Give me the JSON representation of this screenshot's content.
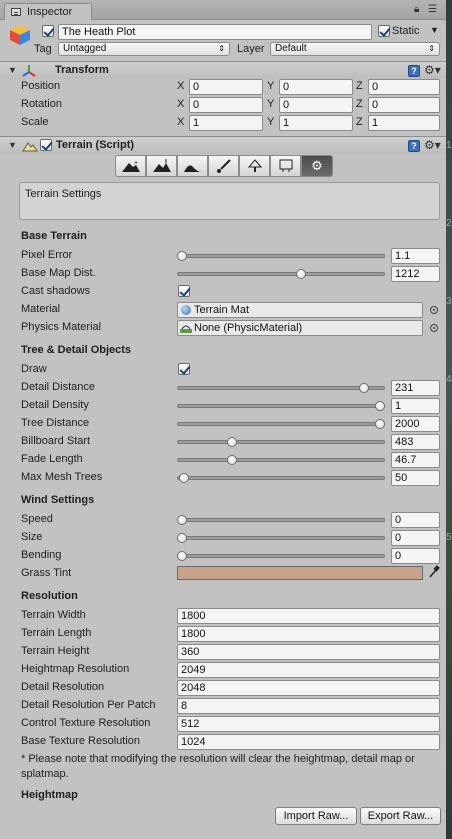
{
  "tab": {
    "title": "Inspector"
  },
  "object": {
    "name": "The Heath Plot",
    "static_label": "Static",
    "tag_label": "Tag",
    "tag_value": "Untagged",
    "layer_label": "Layer",
    "layer_value": "Default"
  },
  "transform": {
    "title": "Transform",
    "rows": [
      {
        "label": "Position",
        "x": "0",
        "y": "0",
        "z": "0"
      },
      {
        "label": "Rotation",
        "x": "0",
        "y": "0",
        "z": "0"
      },
      {
        "label": "Scale",
        "x": "1",
        "y": "1",
        "z": "1"
      }
    ],
    "axis": {
      "x": "X",
      "y": "Y",
      "z": "Z"
    }
  },
  "terrain": {
    "title": "Terrain (Script)",
    "settings_text": "Terrain Settings",
    "base": {
      "heading": "Base Terrain",
      "pixel_error": {
        "label": "Pixel Error",
        "value": "1.1",
        "fraction": 0.0
      },
      "base_map_dist": {
        "label": "Base Map Dist.",
        "value": "1212",
        "fraction": 0.6
      },
      "cast_shadows": {
        "label": "Cast shadows",
        "checked": true
      },
      "material": {
        "label": "Material",
        "value": "Terrain Mat"
      },
      "physics_material": {
        "label": "Physics Material",
        "value": "None (PhysicMaterial)"
      }
    },
    "tree": {
      "heading": "Tree & Detail Objects",
      "draw": {
        "label": "Draw",
        "checked": true
      },
      "detail_distance": {
        "label": "Detail Distance",
        "value": "231",
        "fraction": 0.92
      },
      "detail_density": {
        "label": "Detail Density",
        "value": "1",
        "fraction": 1.0
      },
      "tree_distance": {
        "label": "Tree Distance",
        "value": "2000",
        "fraction": 1.0
      },
      "billboard_start": {
        "label": "Billboard Start",
        "value": "483",
        "fraction": 0.25
      },
      "fade_length": {
        "label": "Fade Length",
        "value": "46.7",
        "fraction": 0.25
      },
      "max_mesh_trees": {
        "label": "Max Mesh Trees",
        "value": "50",
        "fraction": 0.01
      }
    },
    "wind": {
      "heading": "Wind Settings",
      "speed": {
        "label": "Speed",
        "value": "0",
        "fraction": 0.0
      },
      "size": {
        "label": "Size",
        "value": "0",
        "fraction": 0.0
      },
      "bending": {
        "label": "Bending",
        "value": "0",
        "fraction": 0.0
      },
      "grass_tint": {
        "label": "Grass Tint",
        "color": "#c5a289"
      }
    },
    "resolution": {
      "heading": "Resolution",
      "rows": [
        {
          "label": "Terrain Width",
          "value": "1800"
        },
        {
          "label": "Terrain Length",
          "value": "1800"
        },
        {
          "label": "Terrain Height",
          "value": "360"
        },
        {
          "label": "Heightmap Resolution",
          "value": "2049"
        },
        {
          "label": "Detail Resolution",
          "value": "2048"
        },
        {
          "label": "Detail Resolution Per Patch",
          "value": "8"
        },
        {
          "label": "Control Texture Resolution",
          "value": "512"
        },
        {
          "label": "Base Texture Resolution",
          "value": "1024"
        }
      ],
      "note": "* Please note that modifying the resolution will clear the heightmap, detail map or splatmap."
    },
    "heightmap": {
      "heading": "Heightmap",
      "import_label": "Import Raw...",
      "export_label": "Export Raw..."
    }
  },
  "strip_numbers": [
    "1",
    "2",
    "3",
    "4",
    "5"
  ]
}
